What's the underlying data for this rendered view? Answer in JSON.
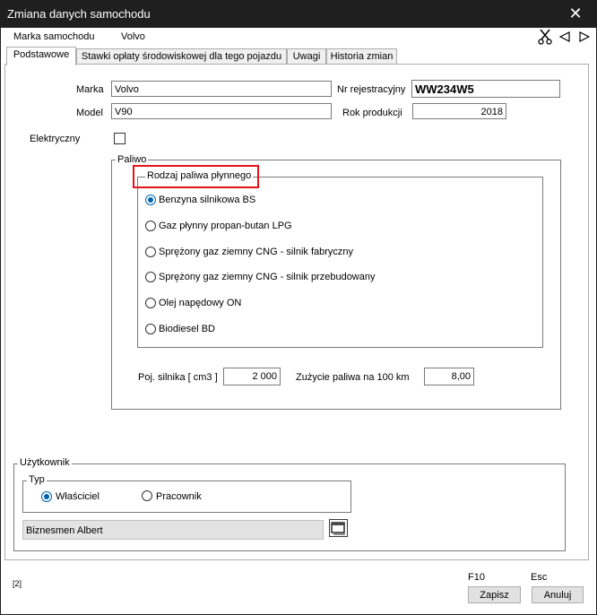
{
  "window": {
    "title": "Zmiana danych samochodu",
    "close_glyph": "✕"
  },
  "infobar": {
    "label": "Marka samochodu",
    "value": "Volvo",
    "icons": [
      "scissors-icon",
      "arrow-left-icon",
      "arrow-right-icon"
    ]
  },
  "tabs": [
    {
      "label": "Podstawowe",
      "active": true
    },
    {
      "label": "Stawki opłaty środowiskowej dla tego pojazdu",
      "active": false
    },
    {
      "label": "Uwagi",
      "active": false
    },
    {
      "label": "Historia zmian",
      "active": false
    }
  ],
  "vehicle": {
    "make_label": "Marka",
    "make_value": "Volvo",
    "model_label": "Model",
    "model_value": "V90",
    "reg_label": "Nr rejestracyjny",
    "reg_value": "WW234W5",
    "year_label": "Rok produkcji",
    "year_value": "2018",
    "electric_label": "Elektryczny",
    "electric_checked": false
  },
  "fuel": {
    "group_title": "Paliwo",
    "liquid_title": "Rodzaj paliwa płynnego",
    "options": [
      {
        "label": "Benzyna silnikowa BS",
        "selected": true
      },
      {
        "label": "Gaz płynny propan-butan LPG",
        "selected": false
      },
      {
        "label": "Sprężony gaz ziemny CNG - silnik fabryczny",
        "selected": false
      },
      {
        "label": "Sprężony gaz ziemny CNG - silnik przebudowany",
        "selected": false
      },
      {
        "label": "Olej napędowy ON",
        "selected": false
      },
      {
        "label": "Biodiesel BD",
        "selected": false
      }
    ],
    "engine_label": "Poj. silnika [ cm3 ]",
    "engine_value": "2 000",
    "consumption_label": "Zużycie paliwa na 100 km",
    "consumption_value": "8,00"
  },
  "user": {
    "group_title": "Użytkownik",
    "type_title": "Typ",
    "owner_label": "Właściciel",
    "owner_selected": true,
    "employee_label": "Pracownik",
    "employee_selected": false,
    "name_value": "Biznesmen Albert"
  },
  "footer": {
    "marker": "[2]",
    "save_key": "F10",
    "save_label": "Zapisz",
    "cancel_key": "Esc",
    "cancel_label": "Anuluj"
  },
  "colors": {
    "titlebar": "#1f1f1f",
    "accent": "#0063b1",
    "highlight": "#e0161b"
  }
}
